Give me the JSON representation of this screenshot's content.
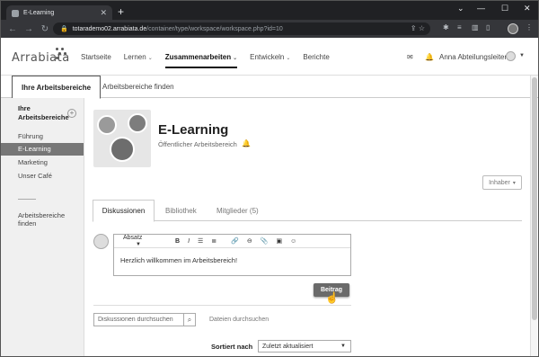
{
  "browser": {
    "tab_title": "E-Learning",
    "tab_close": "✕",
    "new_tab": "+",
    "url_host": "totarademo02.arrabiata.de",
    "url_path": "/container/type/workspace/workspace.php?id=10"
  },
  "app": {
    "logo": "Arrabiata",
    "nav": [
      {
        "label": "Startseite",
        "dropdown": false
      },
      {
        "label": "Lernen",
        "dropdown": true
      },
      {
        "label": "Zusammenarbeiten",
        "dropdown": true,
        "active": true
      },
      {
        "label": "Entwickeln",
        "dropdown": true
      },
      {
        "label": "Berichte",
        "dropdown": false
      }
    ],
    "user_name": "Anna Abteilungsleiterin"
  },
  "page_tabs": {
    "your_workspaces": "Ihre Arbeitsbereiche",
    "find_workspaces": "Arbeitsbereiche finden"
  },
  "sidebar": {
    "title": "Ihre Arbeitsbereiche",
    "add": "+",
    "items": [
      "Führung",
      "E-Learning",
      "Marketing",
      "Unser Café"
    ],
    "active_index": 1,
    "find_link": "Arbeitsbereiche finden"
  },
  "workspace": {
    "title": "E-Learning",
    "subtitle": "Öffentlicher Arbeitsbereich",
    "owner_button": "Inhaber"
  },
  "content_tabs": [
    "Diskussionen",
    "Bibliothek",
    "Mitglieder (5)"
  ],
  "editor": {
    "format_select": "Absatz",
    "text": "Herzlich willkommen im Arbeitsbereich!",
    "post_button": "Beitrag"
  },
  "search": {
    "placeholder": "Diskussionen durchsuchen",
    "files_link": "Dateien durchsuchen"
  },
  "sort": {
    "label": "Sortiert nach",
    "value": "Zuletzt aktualisiert"
  }
}
